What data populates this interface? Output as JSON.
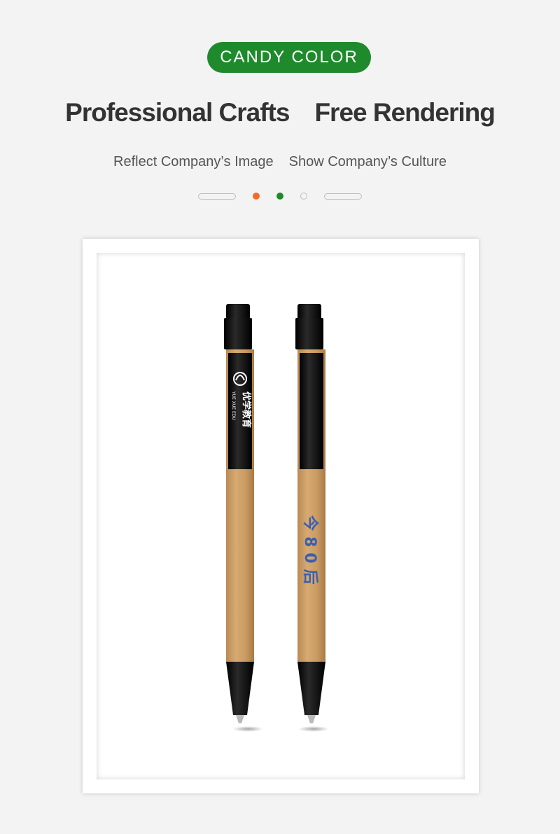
{
  "badge": {
    "label": "CANDY COLOR",
    "color": "#1e8a2c"
  },
  "headline": {
    "left": "Professional Crafts",
    "right": "Free Rendering"
  },
  "subline": {
    "left": "Reflect Company’s Image",
    "right": "Show Company’s Culture"
  },
  "indicator": {
    "dots": [
      "orange",
      "green",
      "hollow"
    ]
  },
  "product": {
    "pen_left": {
      "brand_cn": "优学教育",
      "brand_en": "YUE XUE EDU"
    },
    "pen_right": {
      "print_text": "今80后"
    }
  },
  "colors": {
    "accent_green": "#1e8a2c",
    "accent_orange": "#f26b2a",
    "kraft": "#c89a62",
    "pen_black": "#111111",
    "print_blue": "#3a5fb0"
  }
}
